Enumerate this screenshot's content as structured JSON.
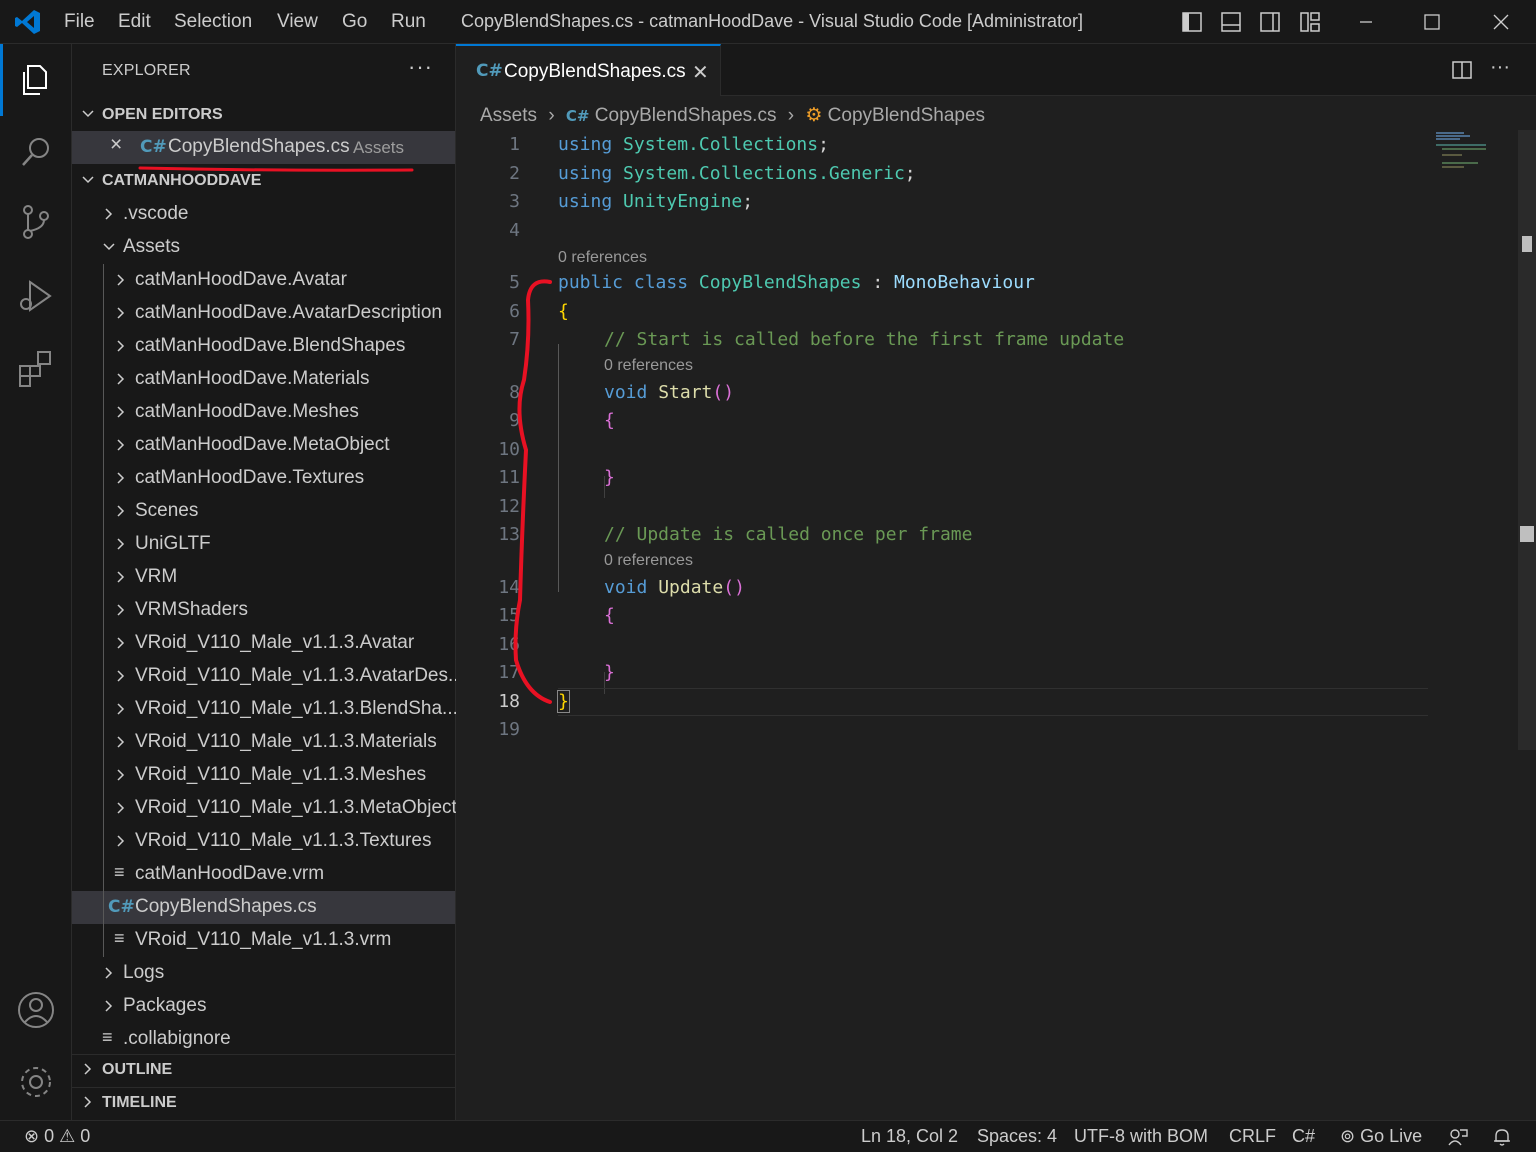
{
  "titlebar": {
    "menu": [
      "File",
      "Edit",
      "Selection",
      "View",
      "Go",
      "Run"
    ],
    "window_title": "CopyBlendShapes.cs - catmanHoodDave - Visual Studio Code [Administrator]"
  },
  "sidebar": {
    "title": "EXPLORER",
    "more": "···",
    "open_editors_label": "OPEN EDITORS",
    "open_editor": {
      "name": "CopyBlendShapes.cs",
      "folder": "Assets"
    },
    "workspace_label": "CATMANHOODDAVE",
    "tree": [
      {
        "label": ".vscode",
        "type": "folder",
        "depth": 0,
        "expanded": false
      },
      {
        "label": "Assets",
        "type": "folder",
        "depth": 0,
        "expanded": true
      },
      {
        "label": "catManHoodDave.Avatar",
        "type": "folder",
        "depth": 1
      },
      {
        "label": "catManHoodDave.AvatarDescription",
        "type": "folder",
        "depth": 1
      },
      {
        "label": "catManHoodDave.BlendShapes",
        "type": "folder",
        "depth": 1
      },
      {
        "label": "catManHoodDave.Materials",
        "type": "folder",
        "depth": 1
      },
      {
        "label": "catManHoodDave.Meshes",
        "type": "folder",
        "depth": 1
      },
      {
        "label": "catManHoodDave.MetaObject",
        "type": "folder",
        "depth": 1
      },
      {
        "label": "catManHoodDave.Textures",
        "type": "folder",
        "depth": 1
      },
      {
        "label": "Scenes",
        "type": "folder",
        "depth": 1
      },
      {
        "label": "UniGLTF",
        "type": "folder",
        "depth": 1
      },
      {
        "label": "VRM",
        "type": "folder",
        "depth": 1
      },
      {
        "label": "VRMShaders",
        "type": "folder",
        "depth": 1
      },
      {
        "label": "VRoid_V110_Male_v1.1.3.Avatar",
        "type": "folder",
        "depth": 1
      },
      {
        "label": "VRoid_V110_Male_v1.1.3.AvatarDes...",
        "type": "folder",
        "depth": 1
      },
      {
        "label": "VRoid_V110_Male_v1.1.3.BlendSha...",
        "type": "folder",
        "depth": 1
      },
      {
        "label": "VRoid_V110_Male_v1.1.3.Materials",
        "type": "folder",
        "depth": 1
      },
      {
        "label": "VRoid_V110_Male_v1.1.3.Meshes",
        "type": "folder",
        "depth": 1
      },
      {
        "label": "VRoid_V110_Male_v1.1.3.MetaObject",
        "type": "folder",
        "depth": 1
      },
      {
        "label": "VRoid_V110_Male_v1.1.3.Textures",
        "type": "folder",
        "depth": 1
      },
      {
        "label": "catManHoodDave.vrm",
        "type": "file",
        "depth": 1
      },
      {
        "label": "CopyBlendShapes.cs",
        "type": "cs",
        "depth": 1,
        "selected": true
      },
      {
        "label": "VRoid_V110_Male_v1.1.3.vrm",
        "type": "file",
        "depth": 1
      },
      {
        "label": "Logs",
        "type": "folder",
        "depth": 0
      },
      {
        "label": "Packages",
        "type": "folder",
        "depth": 0
      },
      {
        "label": ".collabignore",
        "type": "file",
        "depth": 0
      }
    ],
    "outline_label": "OUTLINE",
    "timeline_label": "TIMELINE"
  },
  "editor": {
    "tab_label": "CopyBlendShapes.cs",
    "breadcrumb": {
      "folder": "Assets",
      "file": "CopyBlendShapes.cs",
      "symbol": "CopyBlendShapes"
    },
    "line_numbers": [
      "1",
      "2",
      "3",
      "4",
      "5",
      "6",
      "7",
      "8",
      "9",
      "10",
      "11",
      "12",
      "13",
      "14",
      "15",
      "16",
      "17",
      "18",
      "19"
    ],
    "current_line": "18",
    "codelens": "0 references",
    "code": {
      "l1_kw": "using",
      "l1_ns": "System.Collections",
      "l1_end": ";",
      "l2_kw": "using",
      "l2_ns": "System.Collections.Generic",
      "l2_end": ";",
      "l3_kw": "using",
      "l3_ns": "UnityEngine",
      "l3_end": ";",
      "l5_kw1": "public",
      "l5_kw2": "class",
      "l5_cls": "CopyBlendShapes",
      "l5_colon": ":",
      "l5_base": "MonoBehaviour",
      "l6": "{",
      "l7": "// Start is called before the first frame update",
      "l8_kw": "void",
      "l8_fn": "Start",
      "l8_paren": "()",
      "l9": "{",
      "l11": "}",
      "l13": "// Update is called once per frame",
      "l14_kw": "void",
      "l14_fn": "Update",
      "l14_paren": "()",
      "l15": "{",
      "l17": "}",
      "l18": "}"
    }
  },
  "statusbar": {
    "errors": "0",
    "warnings": "0",
    "position": "Ln 18, Col 2",
    "spaces": "Spaces: 4",
    "encoding": "UTF-8 with BOM",
    "eol": "CRLF",
    "language": "C#",
    "golive": "Go Live"
  },
  "colors": {
    "accent": "#0078d4",
    "annotation": "#e81123",
    "keyword": "#569cd6",
    "type": "#4ec9b0",
    "comment": "#6a9955",
    "function": "#dcdcaa"
  }
}
